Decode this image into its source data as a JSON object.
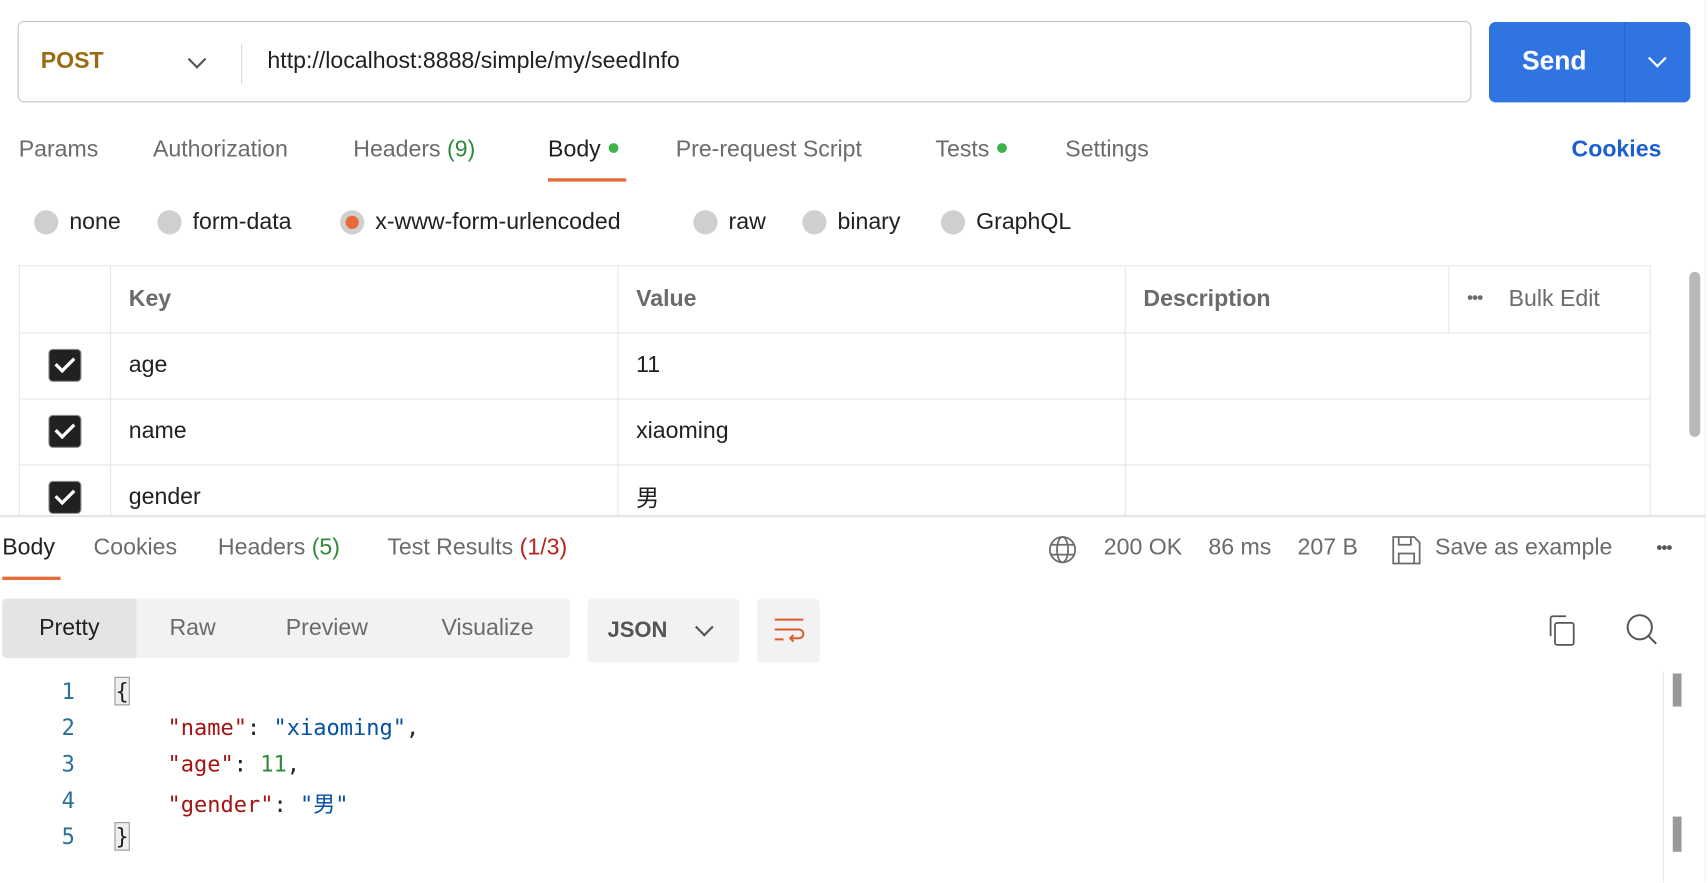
{
  "request": {
    "method": "POST",
    "url": "http://localhost:8888/simple/my/seedInfo",
    "send_label": "Send"
  },
  "request_tabs": [
    {
      "label": "Params"
    },
    {
      "label": "Authorization"
    },
    {
      "label": "Headers",
      "count": "(9)"
    },
    {
      "label": "Body",
      "active": true,
      "dot": true
    },
    {
      "label": "Pre-request Script"
    },
    {
      "label": "Tests",
      "dot": true
    },
    {
      "label": "Settings"
    }
  ],
  "cookies_link": "Cookies",
  "body_types": [
    {
      "label": "none"
    },
    {
      "label": "form-data"
    },
    {
      "label": "x-www-form-urlencoded",
      "selected": true
    },
    {
      "label": "raw"
    },
    {
      "label": "binary"
    },
    {
      "label": "GraphQL"
    }
  ],
  "table": {
    "headers": {
      "key": "Key",
      "value": "Value",
      "description": "Description",
      "bulk_edit": "Bulk Edit"
    },
    "rows": [
      {
        "checked": true,
        "key": "age",
        "value": "11",
        "description": ""
      },
      {
        "checked": true,
        "key": "name",
        "value": "xiaoming",
        "description": ""
      },
      {
        "checked": true,
        "key": "gender",
        "value": "男",
        "description": ""
      }
    ]
  },
  "response": {
    "tabs": [
      {
        "label": "Body",
        "active": true
      },
      {
        "label": "Cookies"
      },
      {
        "label": "Headers",
        "count": "(5)"
      },
      {
        "label": "Test Results",
        "count": "(1/3)"
      }
    ],
    "status": "200 OK",
    "time": "86 ms",
    "size": "207 B",
    "save_example": "Save as example",
    "views": [
      "Pretty",
      "Raw",
      "Preview",
      "Visualize"
    ],
    "active_view": "Pretty",
    "format": "JSON",
    "code_lines": [
      "1",
      "2",
      "3",
      "4",
      "5"
    ],
    "json": {
      "open": "{",
      "close": "}",
      "k1": "\"name\"",
      "v1": "\"xiaoming\"",
      "k2": "\"age\"",
      "v2": "11",
      "k3": "\"gender\"",
      "v3": "\"男\""
    }
  },
  "colors": {
    "accent": "#2f74e0",
    "active_tab": "#e8693a",
    "success": "#2f8a3b",
    "method": "#9a6b12"
  }
}
